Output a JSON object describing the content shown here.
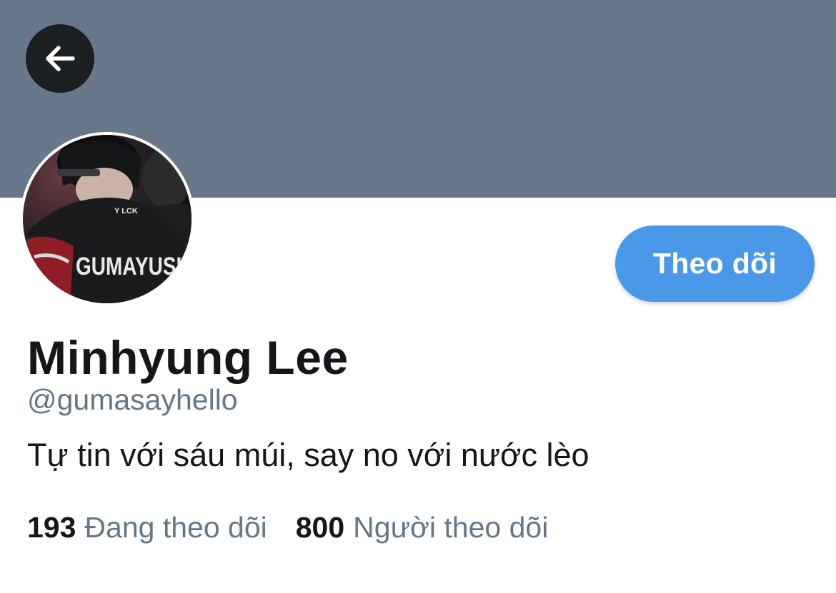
{
  "header": {
    "banner_color": "#67788a",
    "back_icon": "arrow-left-icon"
  },
  "profile": {
    "avatar_text": "GUMAYUSI",
    "display_name": "Minhyung Lee",
    "handle": "@gumasayhello",
    "bio": "Tự tin với sáu múi, say no với nước lèo",
    "follow_label": "Theo dõi",
    "following_count": "193",
    "following_label": "Đang theo dõi",
    "followers_count": "800",
    "followers_label": "Người theo dõi"
  },
  "colors": {
    "accent": "#4a99e9",
    "text_primary": "#14171a",
    "text_secondary": "#657786"
  }
}
